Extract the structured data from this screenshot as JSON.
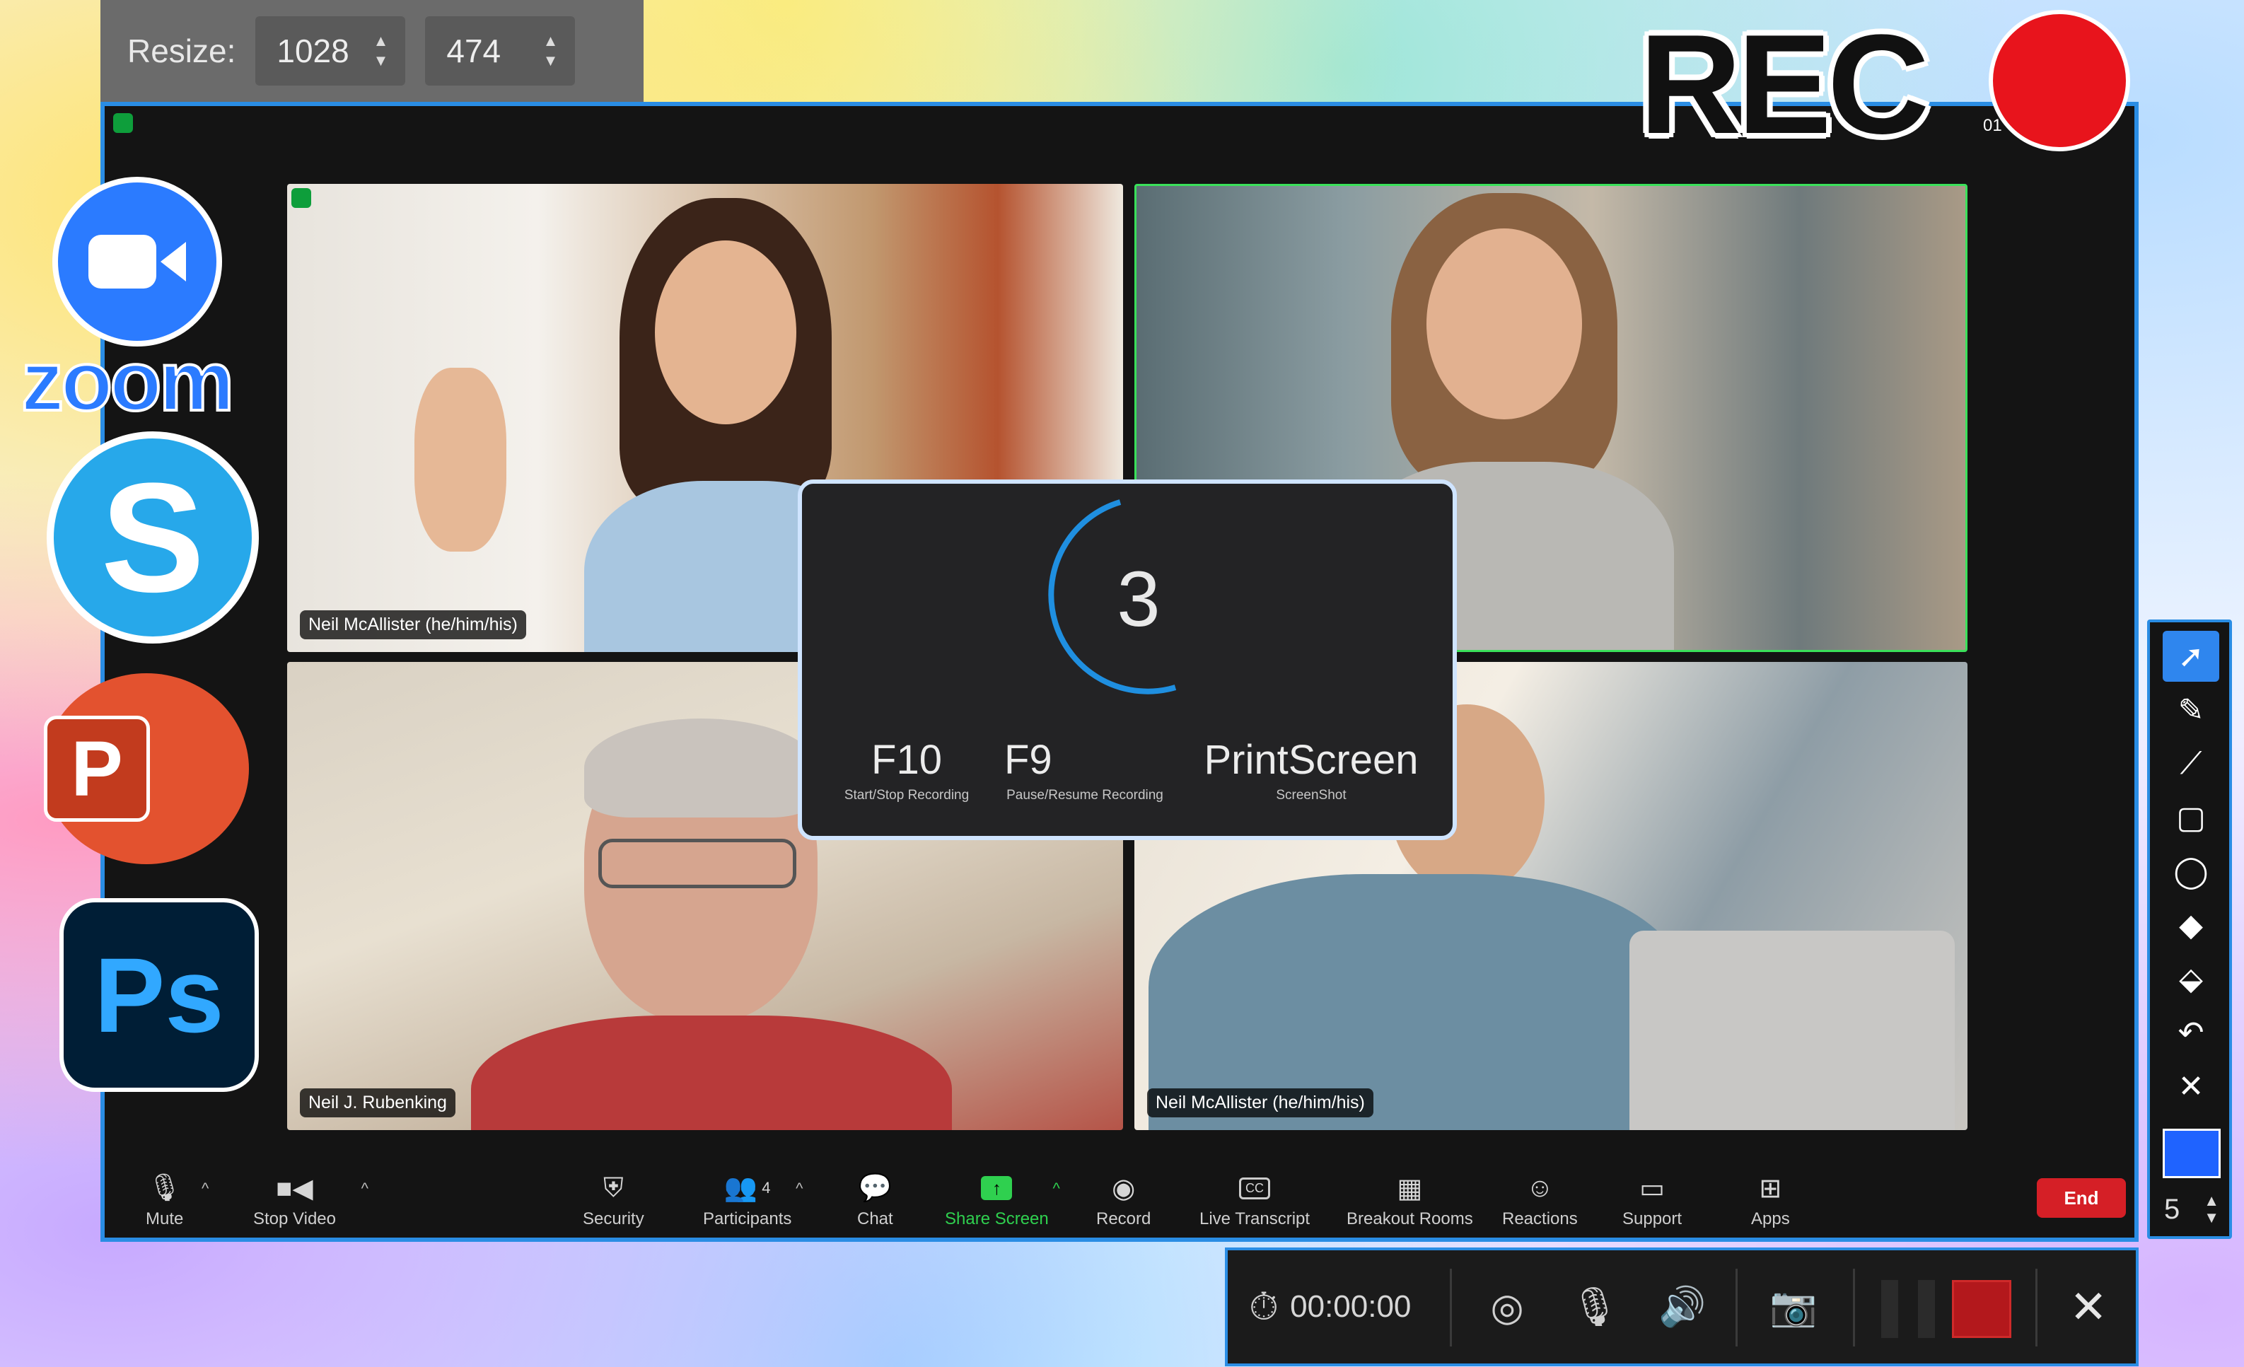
{
  "resize": {
    "label": "Resize:",
    "width_value": "1028",
    "height_value": "474"
  },
  "rec": {
    "label": "REC",
    "time_partial": "01",
    "dot_color": "#e8141c"
  },
  "app_icons": {
    "zoom_word": "zoom",
    "skype_letter": "S",
    "powerpoint_letter": "P",
    "photoshop_text": "Ps"
  },
  "participants": [
    {
      "name": "Neil McAllister (he/him/his)"
    },
    {
      "name": ""
    },
    {
      "name": "Neil J. Rubenking"
    },
    {
      "name": "Neil McAllister (he/him/his)"
    }
  ],
  "countdown": {
    "number": "3",
    "hotkeys": [
      {
        "key": "F10",
        "desc": "Start/Stop Recording"
      },
      {
        "key": "F9",
        "desc": "Pause/Resume Recording"
      },
      {
        "key": "PrintScreen",
        "desc": "ScreenShot"
      }
    ]
  },
  "toolbar": {
    "mute": "Mute",
    "stop_video": "Stop Video",
    "security": "Security",
    "participants": "Participants",
    "participants_count": "4",
    "chat": "Chat",
    "share_screen": "Share Screen",
    "record": "Record",
    "live_transcript": "Live Transcript",
    "breakout_rooms": "Breakout Rooms",
    "reactions": "Reactions",
    "support": "Support",
    "apps": "Apps",
    "end": "End",
    "cc_label": "CC"
  },
  "draw_tools": {
    "selected_color": "#1f63ff",
    "brush_size": "5",
    "icons": [
      "cursor-icon",
      "pen-icon",
      "line-icon",
      "rectangle-icon",
      "lasso-icon",
      "highlighter-icon",
      "eraser-icon",
      "undo-icon",
      "clear-icon"
    ]
  },
  "rec_bar": {
    "timer": "00:00:00"
  },
  "colors": {
    "accent": "#2a8de4",
    "end_button": "#d51f26",
    "share_green": "#2fd04f",
    "active_speaker": "#3ae15a"
  }
}
